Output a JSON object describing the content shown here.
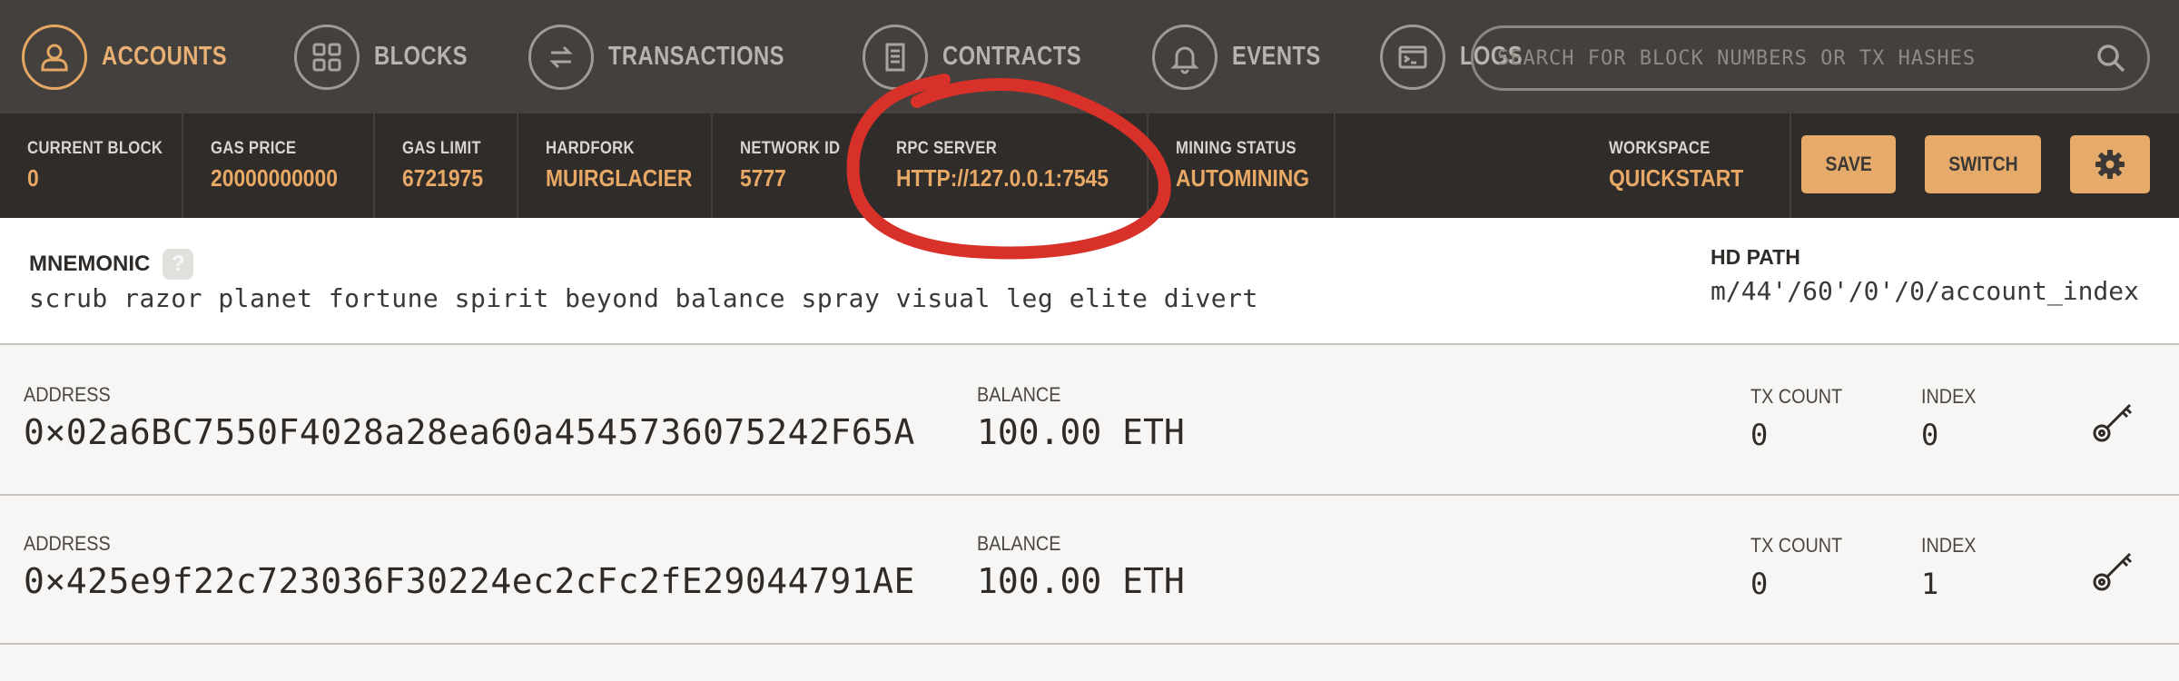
{
  "nav": {
    "items": [
      {
        "label": "ACCOUNTS",
        "icon": "user-icon",
        "active": true
      },
      {
        "label": "BLOCKS",
        "icon": "grid-icon",
        "active": false
      },
      {
        "label": "TRANSACTIONS",
        "icon": "arrows-swap-icon",
        "active": false
      },
      {
        "label": "CONTRACTS",
        "icon": "document-icon",
        "active": false
      },
      {
        "label": "EVENTS",
        "icon": "bell-icon",
        "active": false
      },
      {
        "label": "LOGS",
        "icon": "terminal-icon",
        "active": false
      }
    ],
    "search_placeholder": "SEARCH FOR BLOCK NUMBERS OR TX HASHES"
  },
  "status": {
    "current_block_label": "CURRENT BLOCK",
    "current_block": "0",
    "gas_price_label": "GAS PRICE",
    "gas_price": "20000000000",
    "gas_limit_label": "GAS LIMIT",
    "gas_limit": "6721975",
    "hardfork_label": "HARDFORK",
    "hardfork": "MUIRGLACIER",
    "network_id_label": "NETWORK ID",
    "network_id": "5777",
    "rpc_server_label": "RPC SERVER",
    "rpc_server": "HTTP://127.0.0.1:7545",
    "mining_status_label": "MINING STATUS",
    "mining_status": "AUTOMINING",
    "workspace_label": "WORKSPACE",
    "workspace": "QUICKSTART",
    "save_label": "SAVE",
    "switch_label": "SWITCH"
  },
  "mnemonic": {
    "label": "MNEMONIC",
    "help": "?",
    "words": "scrub razor planet fortune spirit beyond balance spray visual leg elite divert",
    "hd_path_label": "HD PATH",
    "hd_path": "m/44'/60'/0'/0/account_index"
  },
  "accounts": [
    {
      "address_label": "ADDRESS",
      "address": "0×02a6BC7550F4028a28ea60a4545736075242F65A",
      "balance_label": "BALANCE",
      "balance": "100.00 ETH",
      "tx_count_label": "TX COUNT",
      "tx_count": "0",
      "index_label": "INDEX",
      "index": "0"
    },
    {
      "address_label": "ADDRESS",
      "address": "0×425e9f22c723036F30224ec2cFc2fE29044791AE",
      "balance_label": "BALANCE",
      "balance": "100.00 ETH",
      "tx_count_label": "TX COUNT",
      "tx_count": "0",
      "index_label": "INDEX",
      "index": "1"
    }
  ],
  "colors": {
    "nav_bg": "#43403d",
    "status_bg": "#2f2c29",
    "accent": "#e8a866",
    "annotation": "#d8312a"
  }
}
